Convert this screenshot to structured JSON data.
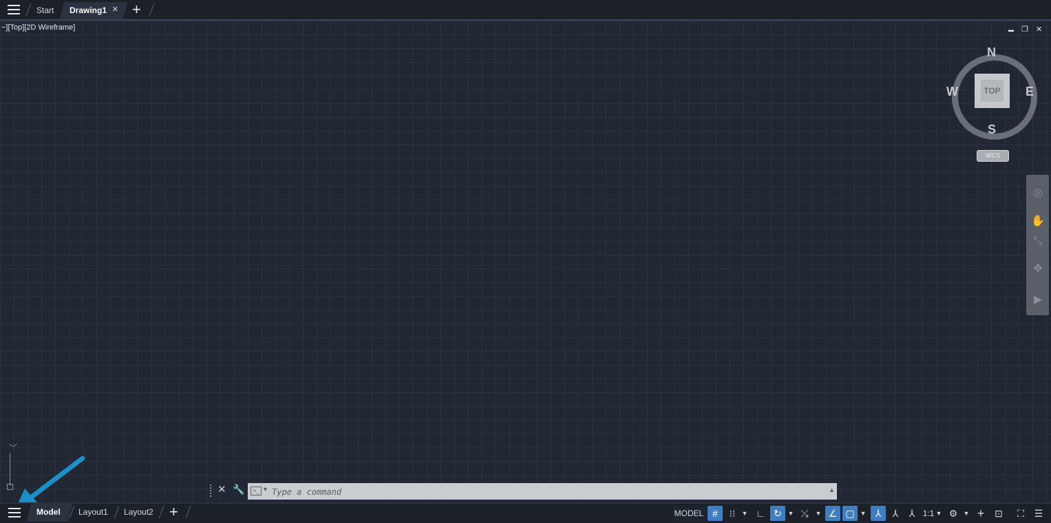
{
  "tabs": {
    "start_label": "Start",
    "active_label": "Drawing1",
    "close_symbol": "×",
    "add_symbol": "+"
  },
  "viewport": {
    "controls_label": "−][Top][2D Wireframe]",
    "minimize_symbol": "▬",
    "restore_symbol": "❐",
    "close_symbol": "✕"
  },
  "viewcube": {
    "north": "N",
    "south": "S",
    "east": "E",
    "west": "W",
    "face": "TOP",
    "wcs": "WCS"
  },
  "command_line": {
    "placeholder": "Type a command"
  },
  "layouts": {
    "model": "Model",
    "layout1": "Layout1",
    "layout2": "Layout2",
    "add_symbol": "+"
  },
  "status_bar": {
    "model_label": "MODEL",
    "scale_label": "1:1",
    "icons": [
      "grid-icon",
      "snap-icon",
      "ortho-icon",
      "polar-icon",
      "isodraft-icon",
      "osnap-icon",
      "lineweight-icon",
      "transparency-icon",
      "annotation-monitor-icon",
      "annotation-scale-icon",
      "workspace-icon",
      "units-icon",
      "quick-properties-icon",
      "fullscreen-icon",
      "customize-icon"
    ]
  },
  "colors": {
    "accent": "#3f7fc1",
    "background": "#212733",
    "annotation_arrow": "#1a8fc9"
  }
}
